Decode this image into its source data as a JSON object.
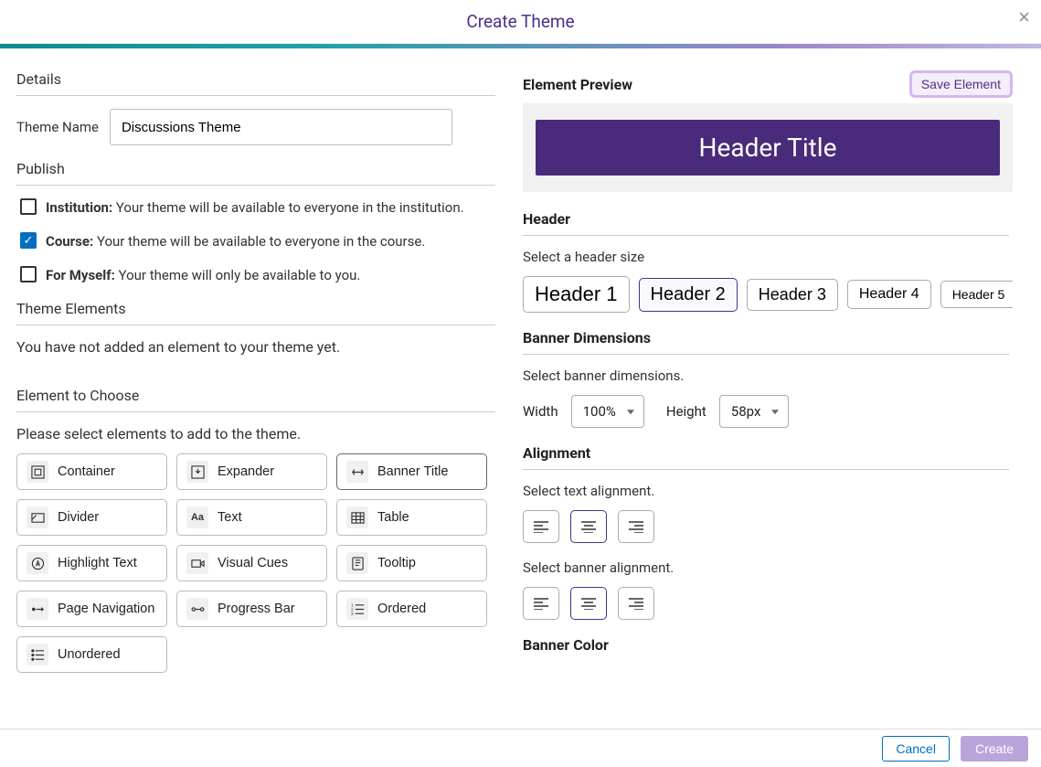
{
  "modal": {
    "title": "Create Theme",
    "close": "×"
  },
  "details": {
    "heading": "Details",
    "themeNameLabel": "Theme Name",
    "themeNameValue": "Discussions Theme"
  },
  "publish": {
    "heading": "Publish",
    "items": [
      {
        "key": "institution",
        "label": "Institution:",
        "desc": " Your theme will be available to everyone in the institution.",
        "checked": false
      },
      {
        "key": "course",
        "label": "Course:",
        "desc": " Your theme will be available to everyone in the course.",
        "checked": true
      },
      {
        "key": "myself",
        "label": "For Myself:",
        "desc": " Your theme will only be available to you.",
        "checked": false
      }
    ]
  },
  "themeElements": {
    "heading": "Theme Elements",
    "empty": "You have not added an element to your theme yet."
  },
  "choose": {
    "heading": "Element to Choose",
    "prompt": "Please select elements to add to the theme.",
    "items": [
      {
        "key": "container",
        "label": "Container"
      },
      {
        "key": "expander",
        "label": "Expander"
      },
      {
        "key": "banner-title",
        "label": "Banner Title",
        "selected": true
      },
      {
        "key": "divider",
        "label": "Divider"
      },
      {
        "key": "text",
        "label": "Text"
      },
      {
        "key": "table",
        "label": "Table"
      },
      {
        "key": "highlight-text",
        "label": "Highlight Text"
      },
      {
        "key": "visual-cues",
        "label": "Visual Cues"
      },
      {
        "key": "tooltip",
        "label": "Tooltip"
      },
      {
        "key": "page-navigation",
        "label": "Page Navigation"
      },
      {
        "key": "progress-bar",
        "label": "Progress Bar"
      },
      {
        "key": "ordered",
        "label": "Ordered"
      },
      {
        "key": "unordered",
        "label": "Unordered"
      }
    ]
  },
  "preview": {
    "heading": "Element Preview",
    "saveLabel": "Save Element",
    "bannerText": "Header Title"
  },
  "headerSec": {
    "heading": "Header",
    "prompt": "Select a header size",
    "options": [
      "Header 1",
      "Header 2",
      "Header 3",
      "Header 4",
      "Header 5"
    ],
    "selected": "Header 2"
  },
  "dims": {
    "heading": "Banner Dimensions",
    "prompt": "Select banner dimensions.",
    "widthLabel": "Width",
    "widthValue": "100%",
    "heightLabel": "Height",
    "heightValue": "58px"
  },
  "alignment": {
    "heading": "Alignment",
    "textPrompt": "Select text alignment.",
    "bannerPrompt": "Select banner alignment.",
    "textSelected": "center",
    "bannerSelected": "center"
  },
  "bannerColor": {
    "heading": "Banner Color"
  },
  "footer": {
    "cancel": "Cancel",
    "create": "Create"
  }
}
